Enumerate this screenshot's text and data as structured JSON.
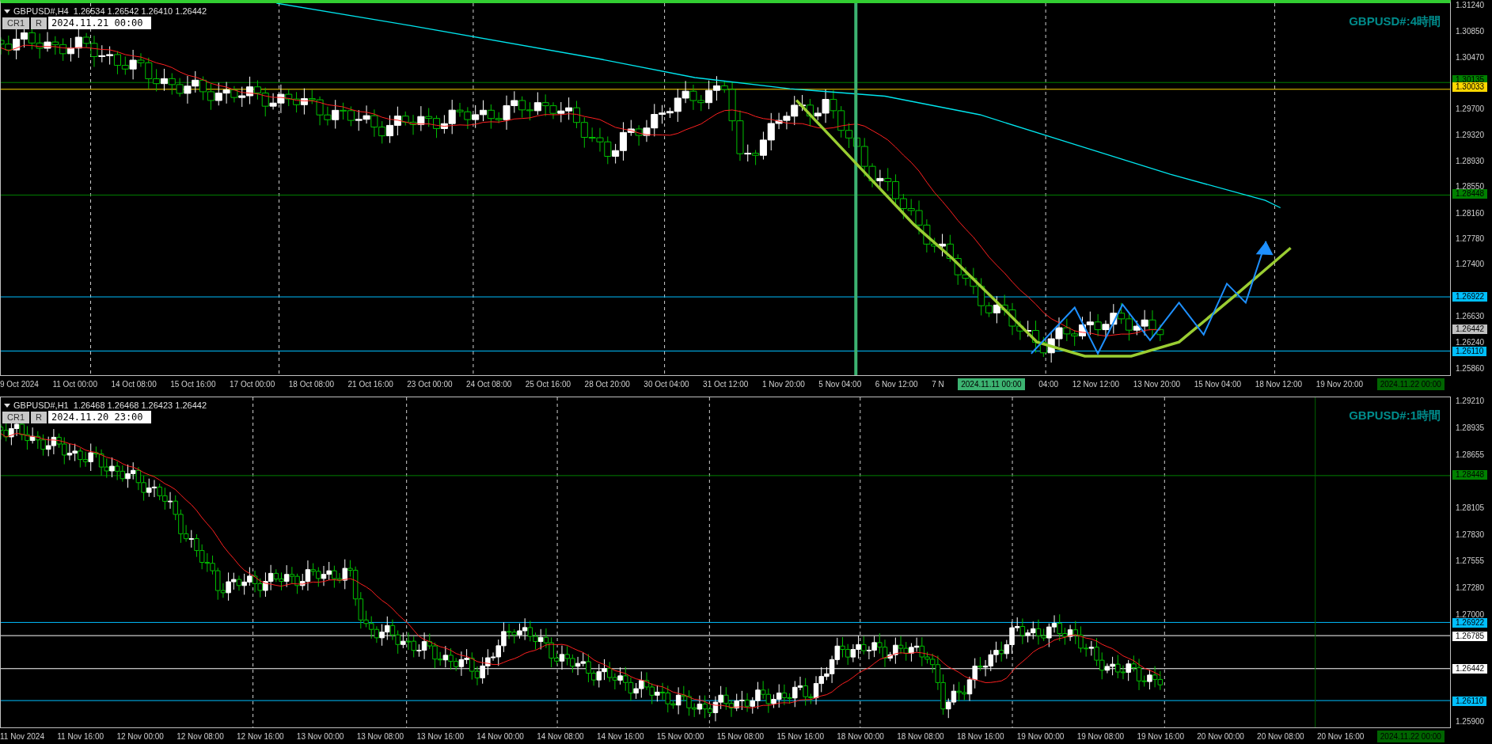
{
  "panels": [
    {
      "header": "GBPUSD#,H4  1.26534 1.26542 1.26410 1.26442",
      "buttons": [
        "CR1",
        "R"
      ],
      "date_field": "2024.11.21 00:00",
      "title": "GBPUSD#:4時間",
      "price_ticks": [
        "1.31240",
        "1.30850",
        "1.30470",
        "1.29700",
        "1.29320",
        "1.28930",
        "1.28550",
        "1.28160",
        "1.27780",
        "1.27400",
        "1.26630",
        "1.26240",
        "1.25860"
      ],
      "price_tags": [
        {
          "text": "1.30135",
          "color": "#008000"
        },
        {
          "text": "1.30033",
          "color": "#ffd700"
        },
        {
          "text": "1.28448",
          "color": "#008000"
        },
        {
          "text": "1.26922",
          "color": "#00bfff"
        },
        {
          "text": "1.26442",
          "color": "#c0c0c0"
        },
        {
          "text": "1.26110",
          "color": "#00bfff"
        }
      ],
      "time_labels": [
        {
          "kind": "label",
          "text": "9 Oct 2024"
        },
        {
          "kind": "label",
          "text": "11 Oct 00:00"
        },
        {
          "kind": "label",
          "text": "14 Oct 08:00"
        },
        {
          "kind": "label",
          "text": "15 Oct 16:00"
        },
        {
          "kind": "label",
          "text": "17 Oct 00:00"
        },
        {
          "kind": "label",
          "text": "18 Oct 08:00"
        },
        {
          "kind": "label",
          "text": "21 Oct 16:00"
        },
        {
          "kind": "label",
          "text": "23 Oct 00:00"
        },
        {
          "kind": "label",
          "text": "24 Oct 08:00"
        },
        {
          "kind": "label",
          "text": "25 Oct 16:00"
        },
        {
          "kind": "label",
          "text": "28 Oct 20:00"
        },
        {
          "kind": "label",
          "text": "30 Oct 04:00"
        },
        {
          "kind": "label",
          "text": "31 Oct 12:00"
        },
        {
          "kind": "label",
          "text": "1 Nov 20:00"
        },
        {
          "kind": "label",
          "text": "5 Nov 04:00"
        },
        {
          "kind": "label",
          "text": "6 Nov 12:00"
        },
        {
          "kind": "label",
          "text": "7 N"
        },
        {
          "kind": "marker",
          "text": "2024.11.11 00:00",
          "color": "#3cb371"
        },
        {
          "kind": "label",
          "text": "04:00"
        },
        {
          "kind": "label",
          "text": "12 Nov 12:00"
        },
        {
          "kind": "label",
          "text": "13 Nov 20:00"
        },
        {
          "kind": "label",
          "text": "15 Nov 04:00"
        },
        {
          "kind": "label",
          "text": "18 Nov 12:00"
        },
        {
          "kind": "label",
          "text": "19 Nov 20:00"
        },
        {
          "kind": "marker",
          "text": "2024.11.22 00:00",
          "color": "#006400"
        }
      ]
    },
    {
      "header": "GBPUSD#,H1  1.26468 1.26468 1.26423 1.26442",
      "buttons": [
        "CR1",
        "R"
      ],
      "date_field": "2024.11.20 23:00",
      "title": "GBPUSD#:1時間",
      "price_ticks": [
        "1.29210",
        "1.28935",
        "1.28655",
        "1.28105",
        "1.27830",
        "1.27555",
        "1.27280",
        "1.27000",
        "1.25900"
      ],
      "price_tags": [
        {
          "text": "1.28448",
          "color": "#008000"
        },
        {
          "text": "1.26922",
          "color": "#00bfff"
        },
        {
          "text": "1.26785",
          "color": "#ffffff"
        },
        {
          "text": "1.26442",
          "color": "#ffffff"
        },
        {
          "text": "1.26110",
          "color": "#00bfff"
        }
      ],
      "time_labels": [
        {
          "kind": "label",
          "text": "11 Nov 2024"
        },
        {
          "kind": "label",
          "text": "11 Nov 16:00"
        },
        {
          "kind": "label",
          "text": "12 Nov 00:00"
        },
        {
          "kind": "label",
          "text": "12 Nov 08:00"
        },
        {
          "kind": "label",
          "text": "12 Nov 16:00"
        },
        {
          "kind": "label",
          "text": "13 Nov 00:00"
        },
        {
          "kind": "label",
          "text": "13 Nov 08:00"
        },
        {
          "kind": "label",
          "text": "13 Nov 16:00"
        },
        {
          "kind": "label",
          "text": "14 Nov 00:00"
        },
        {
          "kind": "label",
          "text": "14 Nov 08:00"
        },
        {
          "kind": "label",
          "text": "14 Nov 16:00"
        },
        {
          "kind": "label",
          "text": "15 Nov 00:00"
        },
        {
          "kind": "label",
          "text": "15 Nov 08:00"
        },
        {
          "kind": "label",
          "text": "15 Nov 16:00"
        },
        {
          "kind": "label",
          "text": "18 Nov 00:00"
        },
        {
          "kind": "label",
          "text": "18 Nov 08:00"
        },
        {
          "kind": "label",
          "text": "18 Nov 16:00"
        },
        {
          "kind": "label",
          "text": "19 Nov 00:00"
        },
        {
          "kind": "label",
          "text": "19 Nov 08:00"
        },
        {
          "kind": "label",
          "text": "19 Nov 16:00"
        },
        {
          "kind": "label",
          "text": "20 Nov 00:00"
        },
        {
          "kind": "label",
          "text": "20 Nov 08:00"
        },
        {
          "kind": "label",
          "text": "20 Nov 16:00"
        },
        {
          "kind": "marker",
          "text": "2024.11.22 00:00",
          "color": "#006400"
        }
      ]
    }
  ]
}
